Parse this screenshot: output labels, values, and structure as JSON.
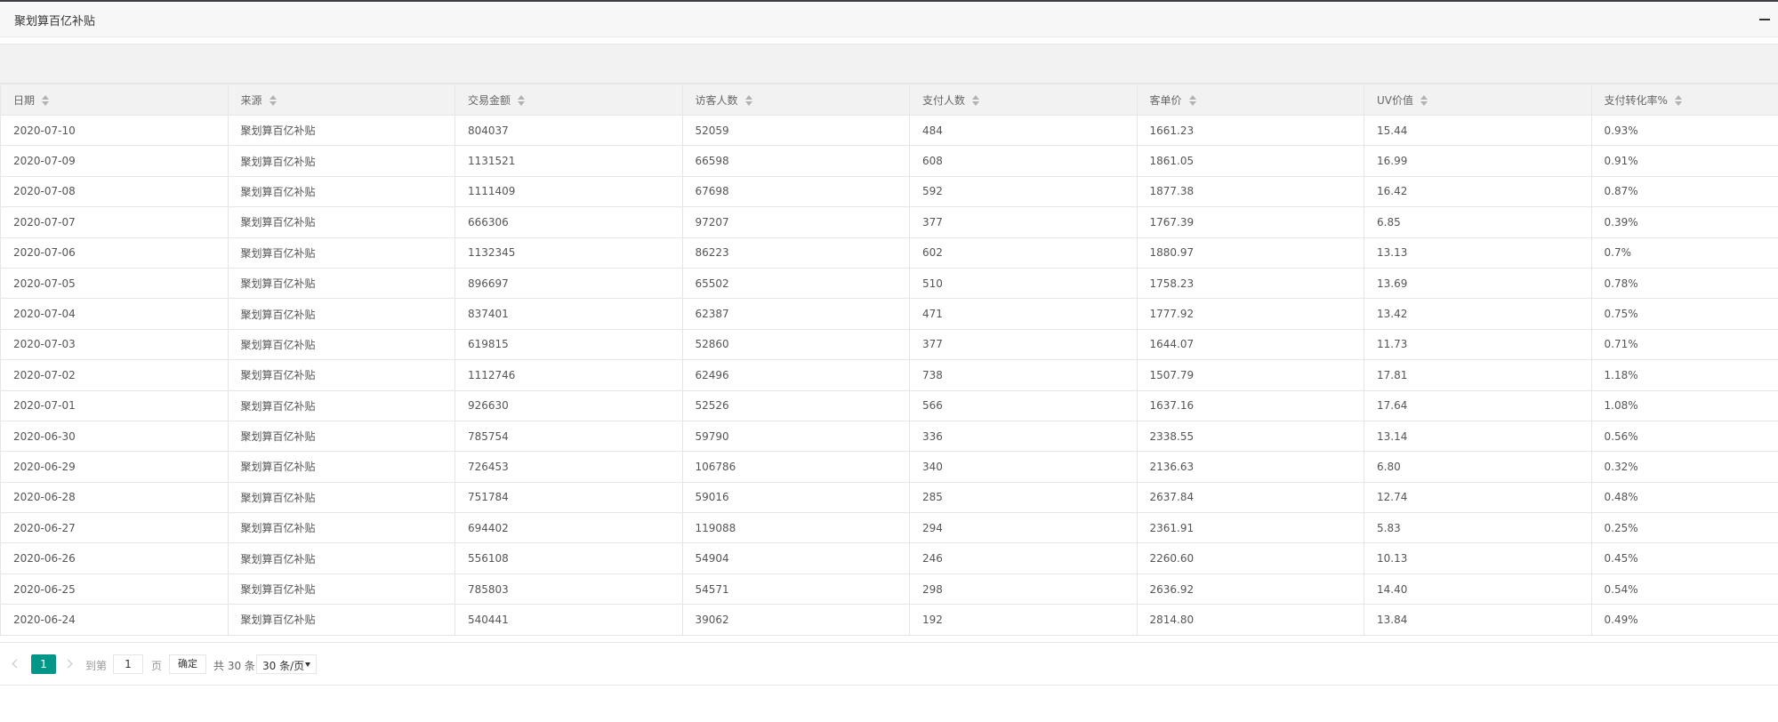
{
  "panel": {
    "title": "聚划算百亿补贴"
  },
  "table": {
    "columns": [
      "日期",
      "来源",
      "交易金额",
      "访客人数",
      "支付人数",
      "客单价",
      "UV价值",
      "支付转化率%"
    ],
    "rows": [
      [
        "2020-07-10",
        "聚划算百亿补贴",
        "804037",
        "52059",
        "484",
        "1661.23",
        "15.44",
        "0.93%"
      ],
      [
        "2020-07-09",
        "聚划算百亿补贴",
        "1131521",
        "66598",
        "608",
        "1861.05",
        "16.99",
        "0.91%"
      ],
      [
        "2020-07-08",
        "聚划算百亿补贴",
        "1111409",
        "67698",
        "592",
        "1877.38",
        "16.42",
        "0.87%"
      ],
      [
        "2020-07-07",
        "聚划算百亿补贴",
        "666306",
        "97207",
        "377",
        "1767.39",
        "6.85",
        "0.39%"
      ],
      [
        "2020-07-06",
        "聚划算百亿补贴",
        "1132345",
        "86223",
        "602",
        "1880.97",
        "13.13",
        "0.7%"
      ],
      [
        "2020-07-05",
        "聚划算百亿补贴",
        "896697",
        "65502",
        "510",
        "1758.23",
        "13.69",
        "0.78%"
      ],
      [
        "2020-07-04",
        "聚划算百亿补贴",
        "837401",
        "62387",
        "471",
        "1777.92",
        "13.42",
        "0.75%"
      ],
      [
        "2020-07-03",
        "聚划算百亿补贴",
        "619815",
        "52860",
        "377",
        "1644.07",
        "11.73",
        "0.71%"
      ],
      [
        "2020-07-02",
        "聚划算百亿补贴",
        "1112746",
        "62496",
        "738",
        "1507.79",
        "17.81",
        "1.18%"
      ],
      [
        "2020-07-01",
        "聚划算百亿补贴",
        "926630",
        "52526",
        "566",
        "1637.16",
        "17.64",
        "1.08%"
      ],
      [
        "2020-06-30",
        "聚划算百亿补贴",
        "785754",
        "59790",
        "336",
        "2338.55",
        "13.14",
        "0.56%"
      ],
      [
        "2020-06-29",
        "聚划算百亿补贴",
        "726453",
        "106786",
        "340",
        "2136.63",
        "6.80",
        "0.32%"
      ],
      [
        "2020-06-28",
        "聚划算百亿补贴",
        "751784",
        "59016",
        "285",
        "2637.84",
        "12.74",
        "0.48%"
      ],
      [
        "2020-06-27",
        "聚划算百亿补贴",
        "694402",
        "119088",
        "294",
        "2361.91",
        "5.83",
        "0.25%"
      ],
      [
        "2020-06-26",
        "聚划算百亿补贴",
        "556108",
        "54904",
        "246",
        "2260.60",
        "10.13",
        "0.45%"
      ],
      [
        "2020-06-25",
        "聚划算百亿补贴",
        "785803",
        "54571",
        "298",
        "2636.92",
        "14.40",
        "0.54%"
      ],
      [
        "2020-06-24",
        "聚划算百亿补贴",
        "540441",
        "39062",
        "192",
        "2814.80",
        "13.84",
        "0.49%"
      ]
    ]
  },
  "pagination": {
    "current_page": "1",
    "goto_label": "到第",
    "goto_value": "1",
    "page_label": "页",
    "confirm_label": "确定",
    "total_label": "共 30 条",
    "page_size_label": "30 条/页"
  }
}
